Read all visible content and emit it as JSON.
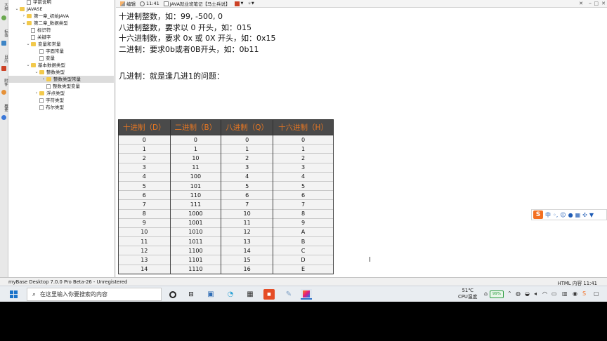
{
  "sidebar_tabs": [
    "大纲",
    "标签",
    "日历",
    "附件",
    "概要"
  ],
  "tree": [
    {
      "label": "学前说明",
      "level": 1,
      "type": "doc",
      "arrow": ""
    },
    {
      "label": "JAVASE",
      "level": 0,
      "type": "folder",
      "arrow": "⌄"
    },
    {
      "label": "第一章_初始JAVA",
      "level": 1,
      "type": "folder",
      "arrow": "›"
    },
    {
      "label": "第二章_数据类型",
      "level": 1,
      "type": "folder",
      "arrow": "⌄"
    },
    {
      "label": "标识符",
      "level": 2,
      "type": "doc",
      "arrow": ""
    },
    {
      "label": "关键字",
      "level": 2,
      "type": "doc",
      "arrow": ""
    },
    {
      "label": "变量和常量",
      "level": 2,
      "type": "folder",
      "arrow": "⌄"
    },
    {
      "label": "字面常量",
      "level": 3,
      "type": "doc",
      "arrow": ""
    },
    {
      "label": "变量",
      "level": 3,
      "type": "doc",
      "arrow": ""
    },
    {
      "label": "基本数据类型",
      "level": 2,
      "type": "folder",
      "arrow": "⌄"
    },
    {
      "label": "整数类型",
      "level": 3,
      "type": "folder",
      "arrow": "⌄"
    },
    {
      "label": "整数类型常量",
      "level": 4,
      "type": "folder",
      "arrow": "›",
      "selected": true
    },
    {
      "label": "整数类型变量",
      "level": 4,
      "type": "doc",
      "arrow": ""
    },
    {
      "label": "浮点类型",
      "level": 3,
      "type": "folder",
      "arrow": "›"
    },
    {
      "label": "字符类型",
      "level": 3,
      "type": "doc",
      "arrow": ""
    },
    {
      "label": "布尔类型",
      "level": 3,
      "type": "doc",
      "arrow": ""
    }
  ],
  "toolbar": {
    "edit_label": "编辑",
    "time": "11:41",
    "doc_title": "JAVA就业班笔记【马士兵说】"
  },
  "doc": {
    "lines": [
      "十进制整数，如：99, -500, 0",
      "八进制整数，要求以 0 开头，如：015",
      "十六进制数，要求 0x 或 0X 开头，如：0x15",
      "二进制：要求0b或者0B开头，如：0b11"
    ],
    "question": "几进制：就是逢几进1的问题："
  },
  "table": {
    "headers": [
      "十进制（D）",
      "二进制（B）",
      "八进制（Q）",
      "十六进制（H）"
    ],
    "rows": [
      [
        "0",
        "0",
        "0",
        "0"
      ],
      [
        "1",
        "1",
        "1",
        "1"
      ],
      [
        "2",
        "10",
        "2",
        "2"
      ],
      [
        "3",
        "11",
        "3",
        "3"
      ],
      [
        "4",
        "100",
        "4",
        "4"
      ],
      [
        "5",
        "101",
        "5",
        "5"
      ],
      [
        "6",
        "110",
        "6",
        "6"
      ],
      [
        "7",
        "111",
        "7",
        "7"
      ],
      [
        "8",
        "1000",
        "10",
        "8"
      ],
      [
        "9",
        "1001",
        "11",
        "9"
      ],
      [
        "10",
        "1010",
        "12",
        "A"
      ],
      [
        "11",
        "1011",
        "13",
        "B"
      ],
      [
        "12",
        "1100",
        "14",
        "C"
      ],
      [
        "13",
        "1101",
        "15",
        "D"
      ],
      [
        "14",
        "1110",
        "16",
        "E"
      ]
    ]
  },
  "ime": {
    "lang": "中"
  },
  "status": {
    "left": "myBase Desktop 7.0.0 Pro Beta-26 - Unregistered",
    "right": "HTML 内容  11:41"
  },
  "taskbar": {
    "search_placeholder": "在这里输入你要搜索的内容",
    "temperature": "51℃",
    "cpu_label": "CPU温度",
    "battery": "99%"
  },
  "colors": {
    "table_header_bg": "#4a4a4a",
    "table_header_text": "#e87722",
    "folder": "#f2c94c",
    "accent": "#2d72c9"
  }
}
